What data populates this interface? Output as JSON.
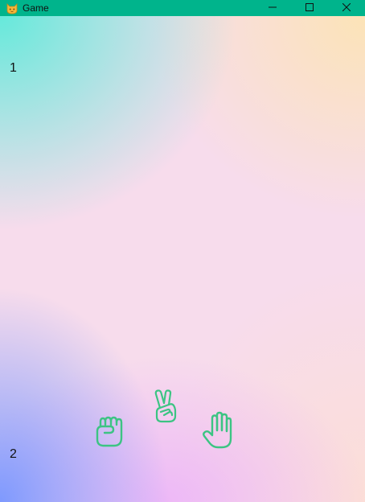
{
  "window": {
    "title": "Game",
    "app_icon": "cat-face-icon",
    "controls": [
      "minimize-icon",
      "maximize-icon",
      "close-icon"
    ]
  },
  "game": {
    "player1_label": "1",
    "player2_label": "2",
    "choices": [
      {
        "name": "rock",
        "icon": "fist-hand-icon"
      },
      {
        "name": "scissors",
        "icon": "victory-hand-icon"
      },
      {
        "name": "paper",
        "icon": "open-hand-icon"
      }
    ],
    "icon_color": "#3cc483",
    "titlebar_color": "#00b48c"
  }
}
